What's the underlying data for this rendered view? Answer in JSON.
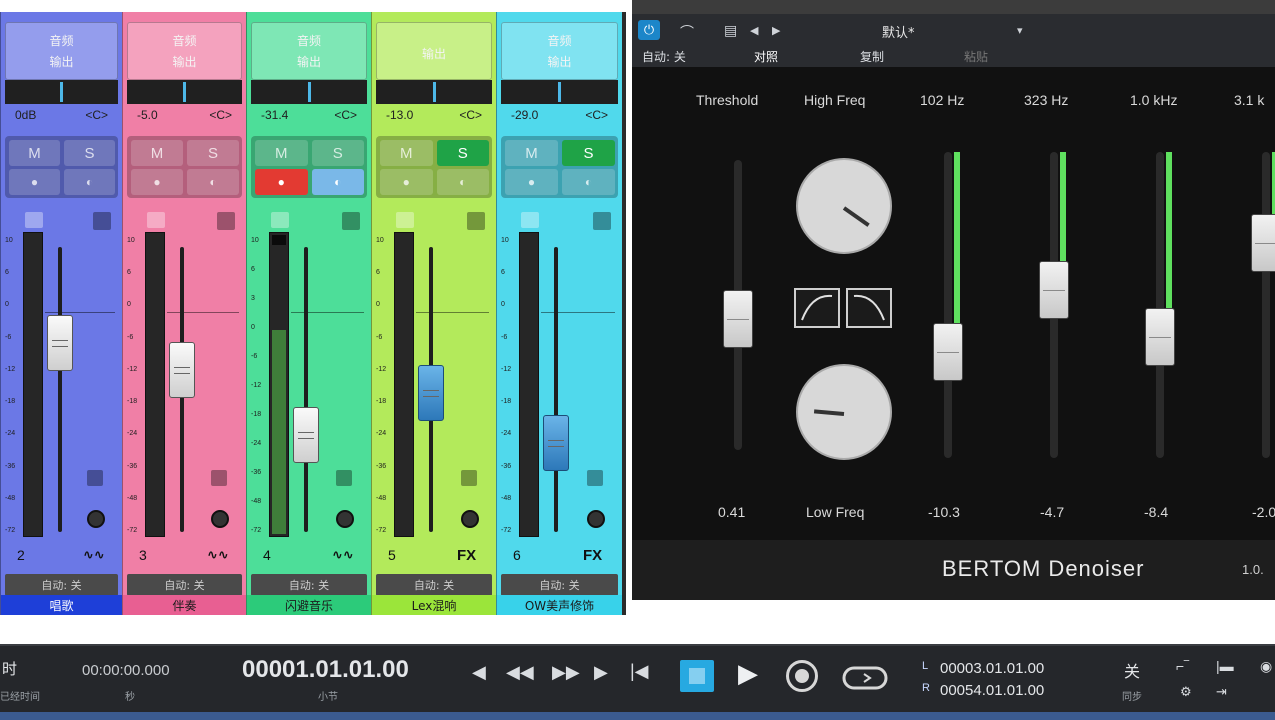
{
  "mixer": {
    "channels": [
      {
        "io_top": "音频",
        "io_bottom": "输出",
        "value": "0dB",
        "pan": "<C>",
        "mute": "M",
        "solo": "S",
        "number": "2",
        "fx": "",
        "automation": "自动: 关",
        "name": "唱歌",
        "scale": [
          "10",
          "6",
          "0",
          "-6",
          "-12",
          "-18",
          "-24",
          "-36",
          "-48",
          "-72"
        ]
      },
      {
        "io_top": "音频",
        "io_bottom": "输出",
        "value": "-5.0",
        "pan": "<C>",
        "mute": "M",
        "solo": "S",
        "number": "3",
        "fx": "",
        "automation": "自动: 关",
        "name": "伴奏",
        "scale": [
          "10",
          "6",
          "0",
          "-6",
          "-12",
          "-18",
          "-24",
          "-36",
          "-48",
          "-72"
        ]
      },
      {
        "io_top": "音频",
        "io_bottom": "输出",
        "value": "-31.4",
        "pan": "<C>",
        "mute": "M",
        "solo": "S",
        "number": "4",
        "fx": "",
        "automation": "自动: 关",
        "name": "闪避音乐",
        "scale": [
          "10",
          "6",
          "3",
          "0",
          "-6",
          "-12",
          "-18",
          "-24",
          "-36",
          "-48",
          "-72"
        ]
      },
      {
        "io_top": "",
        "io_bottom": "输出",
        "value": "-13.0",
        "pan": "<C>",
        "mute": "M",
        "solo": "S",
        "number": "5",
        "fx": "FX",
        "automation": "自动: 关",
        "name": "Lex混响",
        "scale": [
          "10",
          "6",
          "0",
          "-6",
          "-12",
          "-18",
          "-24",
          "-36",
          "-48",
          "-72"
        ]
      },
      {
        "io_top": "音频",
        "io_bottom": "输出",
        "value": "-29.0",
        "pan": "<C>",
        "mute": "M",
        "solo": "S",
        "number": "6",
        "fx": "FX",
        "automation": "自动: 关",
        "name": "OW美声修饰",
        "scale": [
          "10",
          "6",
          "0",
          "-6",
          "-12",
          "-18",
          "-24",
          "-36",
          "-48",
          "-72"
        ]
      }
    ],
    "fader_levels": [
      0.27,
      0.38,
      0.64,
      0.47,
      0.67
    ],
    "meter_levels": [
      0.0,
      0.0,
      0.68,
      0.0,
      0.0
    ],
    "colors": [
      "#6b78e6",
      "#f07fa6",
      "#4dde99",
      "#b3ea5b",
      "#50d9ec"
    ],
    "name_bar_colors": [
      "#1e3fd8",
      "#e85f92",
      "#2ccb7a",
      "#9be53a",
      "#38d2ea"
    ]
  },
  "plugin": {
    "preset_name": "默认*",
    "toolbar_labels": {
      "auto": "自动: 关",
      "compare": "对照",
      "copy": "复制",
      "paste": "粘贴"
    },
    "column_labels": [
      "Threshold",
      "High Freq",
      "102 Hz",
      "323 Hz",
      "1.0 kHz",
      "3.1 k"
    ],
    "value_labels": [
      "0.41",
      "Low Freq",
      "-10.3",
      "-4.7",
      "-8.4",
      "-2.0"
    ],
    "brand": "BERTOM Denoiser",
    "version": "1.0.",
    "threshold_level": 0.56,
    "band_levels": [
      0.31,
      0.56,
      0.37,
      0.75
    ]
  },
  "transport": {
    "left_label": "时",
    "left_sub": "已经时间",
    "time": "00:00:00.000",
    "time_sub": "秒",
    "position": "00001.01.01.00",
    "position_sub": "小节",
    "loop_start": "00003.01.01.00",
    "loop_end": "00054.01.01.00",
    "loop_start_letter": "L",
    "loop_end_letter": "R",
    "sync_label": "关",
    "sync_sub": "同步"
  }
}
